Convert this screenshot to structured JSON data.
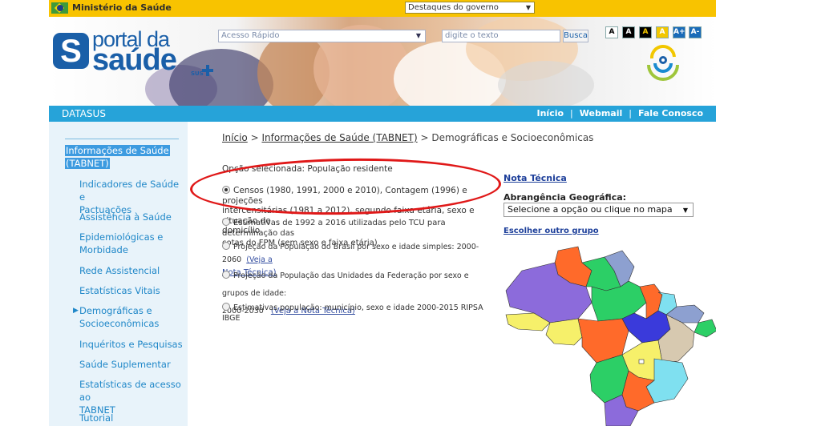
{
  "govbar": {
    "ministry": "Ministério da Saúde",
    "destaques": "Destaques do governo"
  },
  "header": {
    "logo_portal": "portal da",
    "logo_saude": "saúde",
    "logo_sus": "SUS",
    "acesso_placeholder": "Acesso Rápido",
    "search_placeholder": "digite o texto",
    "search_button": "Busca",
    "accessibility": [
      "A",
      "A",
      "A",
      "A",
      "A+",
      "A-"
    ]
  },
  "navbar": {
    "title": "DATASUS",
    "links": [
      "Início",
      "Webmail",
      "Fale Conosco"
    ]
  },
  "sidebar": {
    "selected": [
      "Informações de Saúde",
      "(TABNET)"
    ],
    "items": [
      [
        "Indicadores de Saúde e",
        "Pactuações"
      ],
      [
        "Assistência à Saúde"
      ],
      [
        "Epidemiológicas e",
        "Morbidade"
      ],
      [
        "Rede Assistencial"
      ],
      [
        "Estatísticas Vitais"
      ],
      [
        "Demográficas e",
        "Socioeconômicas"
      ],
      [
        "Inquéritos e Pesquisas"
      ],
      [
        "Saúde Suplementar"
      ],
      [
        "Estatísticas de acesso ao",
        "TABNET"
      ],
      [
        "Tutorial"
      ]
    ]
  },
  "breadcrumb": {
    "home": "Início",
    "tabnet": "Informações de Saúde (TABNET)",
    "current": "Demográficas e Socioeconômicas",
    "sep": ">"
  },
  "main": {
    "opcao": "Opção selecionada: População residente",
    "options": [
      {
        "lines": [
          "Censos (1980, 1991, 2000 e 2010), Contagem (1996) e projeções",
          "intercensitárias (1981 a 2012), segundo faixa etária, sexo e situação de",
          "domicílio"
        ],
        "checked": true
      },
      {
        "lines": [
          "Estimativas de 1992 a 2016 utilizadas pelo TCU para determinação das",
          "cotas do FPM (sem sexo e faixa etária)"
        ],
        "checked": false
      },
      {
        "lines": [
          "Projeção da População do Brasil por sexo e idade simples: 2000-2060"
        ],
        "link": [
          "(Veja a",
          "Nota Técnica)"
        ],
        "checked": false
      },
      {
        "lines": [
          "Projeção da População das Unidades da Federação por sexo e grupos de idade:",
          "2000-2030"
        ],
        "link": [
          "(Veja a Nota Técnica)"
        ],
        "checked": false
      },
      {
        "lines": [
          "Estimativas população: município, sexo e idade 2000-2015 RIPSA IBGE"
        ],
        "checked": false
      }
    ]
  },
  "right": {
    "nota": "Nota Técnica",
    "abrangencia_label": "Abrangência Geográfica:",
    "abrangencia_value": "Selecione a opção ou clique no mapa",
    "escolher": "Escolher outro grupo"
  },
  "colors": {
    "govbar": "#f8c300",
    "navbar": "#26a3d9",
    "sidebar_bg": "#e8f3fa",
    "link_blue": "#1f87c8",
    "highlight": "#e01818"
  }
}
